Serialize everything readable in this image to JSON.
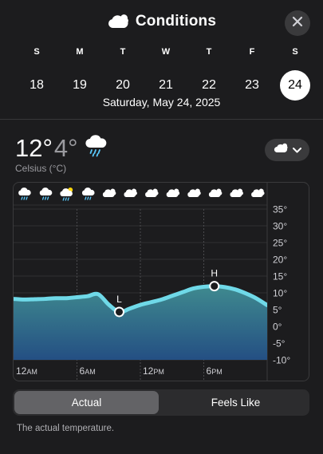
{
  "header": {
    "title": "Conditions",
    "title_icon": "cloud-icon",
    "close_icon": "close-icon"
  },
  "week": {
    "days": [
      {
        "dow": "S",
        "num": "18",
        "selected": false
      },
      {
        "dow": "M",
        "num": "19",
        "selected": false
      },
      {
        "dow": "T",
        "num": "20",
        "selected": false
      },
      {
        "dow": "W",
        "num": "21",
        "selected": false
      },
      {
        "dow": "T",
        "num": "22",
        "selected": false
      },
      {
        "dow": "F",
        "num": "23",
        "selected": false
      },
      {
        "dow": "S",
        "num": "24",
        "selected": true
      }
    ],
    "date_label": "Saturday, May 24, 2025"
  },
  "summary": {
    "high": "12°",
    "low": "4°",
    "condition_icon": "rain-cloud-icon",
    "unit_label": "Celsius (°C)",
    "menu_icon": "cloud-icon",
    "menu_chevron": "chevron-down-icon"
  },
  "hourly_icons": [
    "rain-cloud-icon",
    "rain-cloud-icon",
    "partly-cloudy-rain-icon",
    "rain-cloud-icon",
    "cloud-icon",
    "cloud-icon",
    "cloud-icon",
    "cloud-icon",
    "cloud-icon",
    "cloud-icon",
    "cloud-icon",
    "cloud-icon"
  ],
  "chart_data": {
    "type": "area",
    "x_labels": [
      "12",
      "6",
      "12",
      "6"
    ],
    "x_label_suffixes": [
      "AM",
      "AM",
      "PM",
      "PM"
    ],
    "y_tick_labels": [
      "35°",
      "30°",
      "25°",
      "20°",
      "15°",
      "10°",
      "5°",
      "0°",
      "-5°",
      "-10°"
    ],
    "ylim": [
      -10,
      37
    ],
    "x_hours": [
      0,
      1,
      2,
      3,
      4,
      5,
      6,
      7,
      8,
      9,
      10,
      11,
      12,
      13,
      14,
      15,
      16,
      17,
      18,
      19,
      20,
      21,
      22,
      23,
      24
    ],
    "series": [
      {
        "values": [
          8.2,
          8.0,
          8.1,
          8.2,
          8.4,
          8.4,
          8.7,
          9.0,
          9.6,
          6.5,
          4.3,
          5.3,
          6.4,
          7.2,
          8.0,
          9.1,
          10.2,
          11.3,
          11.8,
          12.0,
          11.7,
          11.0,
          9.8,
          8.3,
          6.3
        ]
      }
    ],
    "low_marker": {
      "label": "L",
      "hour": 10,
      "value": 4.3
    },
    "high_marker": {
      "label": "H",
      "hour": 19,
      "value": 12.0
    },
    "colors": {
      "line": "#6fd9e8",
      "fill_top": "#3f8a8f",
      "fill_bottom": "#244f83",
      "marker": "#1c1c1e"
    }
  },
  "segmented": {
    "actual_label": "Actual",
    "feels_like_label": "Feels Like"
  },
  "footnote": "The actual temperature."
}
